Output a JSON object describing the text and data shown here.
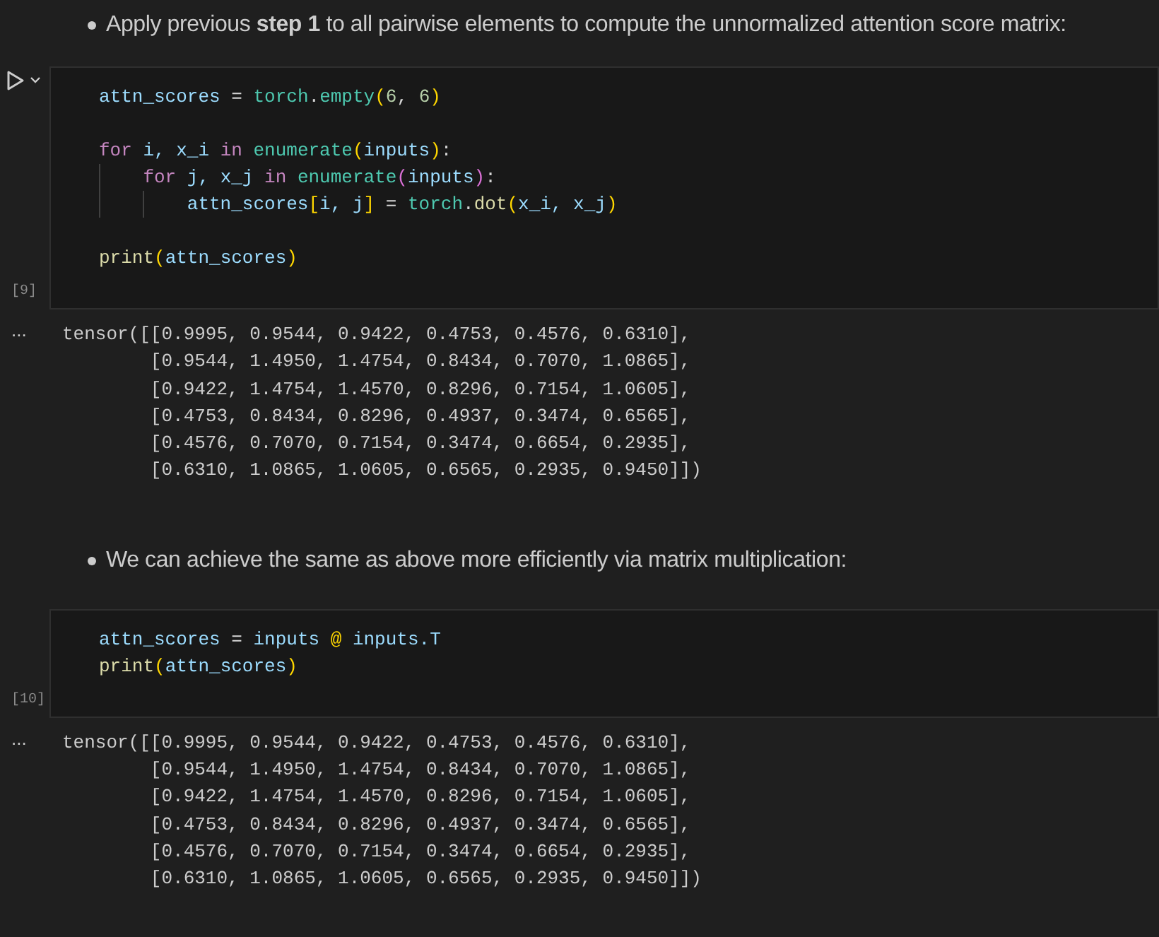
{
  "cells": [
    {
      "kind": "markdown",
      "bullets": [
        "Apply previous **step 1** to all pairwise elements to compute the unnormalized attention score matrix:"
      ]
    },
    {
      "kind": "code",
      "run_button": true,
      "count": "[9]",
      "lines": [
        {
          "kind": "code",
          "tokens": [
            {
              "t": "attn_scores",
              "kind": "var"
            },
            {
              "t": " = ",
              "kind": "op"
            },
            {
              "t": "torch",
              "kind": "cls"
            },
            {
              "t": ".",
              "kind": "plain"
            },
            {
              "t": "empty",
              "kind": "cls"
            },
            {
              "t": "(",
              "kind": "b1"
            },
            {
              "t": "6",
              "kind": "num"
            },
            {
              "t": ", ",
              "kind": "plain"
            },
            {
              "t": "6",
              "kind": "num"
            },
            {
              "t": ")",
              "kind": "b1"
            }
          ]
        },
        {
          "kind": "blank"
        },
        {
          "kind": "code",
          "tokens": [
            {
              "t": "for",
              "kind": "kw"
            },
            {
              "t": " i, x_i ",
              "kind": "var"
            },
            {
              "t": "in",
              "kind": "kw"
            },
            {
              "t": " enumerate",
              "kind": "cls"
            },
            {
              "t": "(",
              "kind": "b1"
            },
            {
              "t": "inputs",
              "kind": "var"
            },
            {
              "t": ")",
              "kind": "b1"
            },
            {
              "t": ":",
              "kind": "plain"
            }
          ],
          "children": [
            {
              "kind": "code",
              "tokens": [
                {
                  "t": "for",
                  "kind": "kw"
                },
                {
                  "t": " j, x_j ",
                  "kind": "var"
                },
                {
                  "t": "in",
                  "kind": "kw"
                },
                {
                  "t": " enumerate",
                  "kind": "cls"
                },
                {
                  "t": "(",
                  "kind": "b2"
                },
                {
                  "t": "inputs",
                  "kind": "var"
                },
                {
                  "t": ")",
                  "kind": "b2"
                },
                {
                  "t": ":",
                  "kind": "plain"
                }
              ],
              "children": [
                {
                  "kind": "code",
                  "tokens": [
                    {
                      "t": "attn_scores",
                      "kind": "var"
                    },
                    {
                      "t": "[",
                      "kind": "b1"
                    },
                    {
                      "t": "i, j",
                      "kind": "var"
                    },
                    {
                      "t": "]",
                      "kind": "b1"
                    },
                    {
                      "t": " = ",
                      "kind": "op"
                    },
                    {
                      "t": "torch",
                      "kind": "cls"
                    },
                    {
                      "t": ".",
                      "kind": "plain"
                    },
                    {
                      "t": "dot",
                      "kind": "fn"
                    },
                    {
                      "t": "(",
                      "kind": "b1"
                    },
                    {
                      "t": "x_i, x_j",
                      "kind": "var"
                    },
                    {
                      "t": ")",
                      "kind": "b1"
                    }
                  ]
                }
              ]
            }
          ]
        },
        {
          "kind": "blank"
        },
        {
          "kind": "code",
          "tokens": [
            {
              "t": "print",
              "kind": "fn"
            },
            {
              "t": "(",
              "kind": "b1"
            },
            {
              "t": "attn_scores",
              "kind": "var"
            },
            {
              "t": ")",
              "kind": "b1"
            }
          ]
        }
      ],
      "output": [
        "tensor([[0.9995, 0.9544, 0.9422, 0.4753, 0.4576, 0.6310],",
        "        [0.9544, 1.4950, 1.4754, 0.8434, 0.7070, 1.0865],",
        "        [0.9422, 1.4754, 1.4570, 0.8296, 0.7154, 1.0605],",
        "        [0.4753, 0.8434, 0.8296, 0.4937, 0.3474, 0.6565],",
        "        [0.4576, 0.7070, 0.7154, 0.3474, 0.6654, 0.2935],",
        "        [0.6310, 1.0865, 1.0605, 0.6565, 0.2935, 0.9450]])"
      ]
    },
    {
      "kind": "markdown",
      "bullets": [
        "We can achieve the same as above more efficiently via matrix multiplication:"
      ]
    },
    {
      "kind": "code",
      "run_button": false,
      "count": "[10]",
      "lines": [
        {
          "kind": "code",
          "tokens": [
            {
              "t": "attn_scores",
              "kind": "var"
            },
            {
              "t": " = ",
              "kind": "op"
            },
            {
              "t": "inputs ",
              "kind": "var"
            },
            {
              "t": "@",
              "kind": "b1"
            },
            {
              "t": " inputs.T",
              "kind": "var"
            }
          ]
        },
        {
          "kind": "code",
          "tokens": [
            {
              "t": "print",
              "kind": "fn"
            },
            {
              "t": "(",
              "kind": "b1"
            },
            {
              "t": "attn_scores",
              "kind": "var"
            },
            {
              "t": ")",
              "kind": "b1"
            }
          ]
        }
      ],
      "output": [
        "tensor([[0.9995, 0.9544, 0.9422, 0.4753, 0.4576, 0.6310],",
        "        [0.9544, 1.4950, 1.4754, 0.8434, 0.7070, 1.0865],",
        "        [0.9422, 1.4754, 1.4570, 0.8296, 0.7154, 1.0605],",
        "        [0.4753, 0.8434, 0.8296, 0.4937, 0.3474, 0.6565],",
        "        [0.4576, 0.7070, 0.7154, 0.3474, 0.6654, 0.2935],",
        "        [0.6310, 1.0865, 1.0605, 0.6565, 0.2935, 0.9450]])"
      ]
    }
  ],
  "output_menu": "..."
}
